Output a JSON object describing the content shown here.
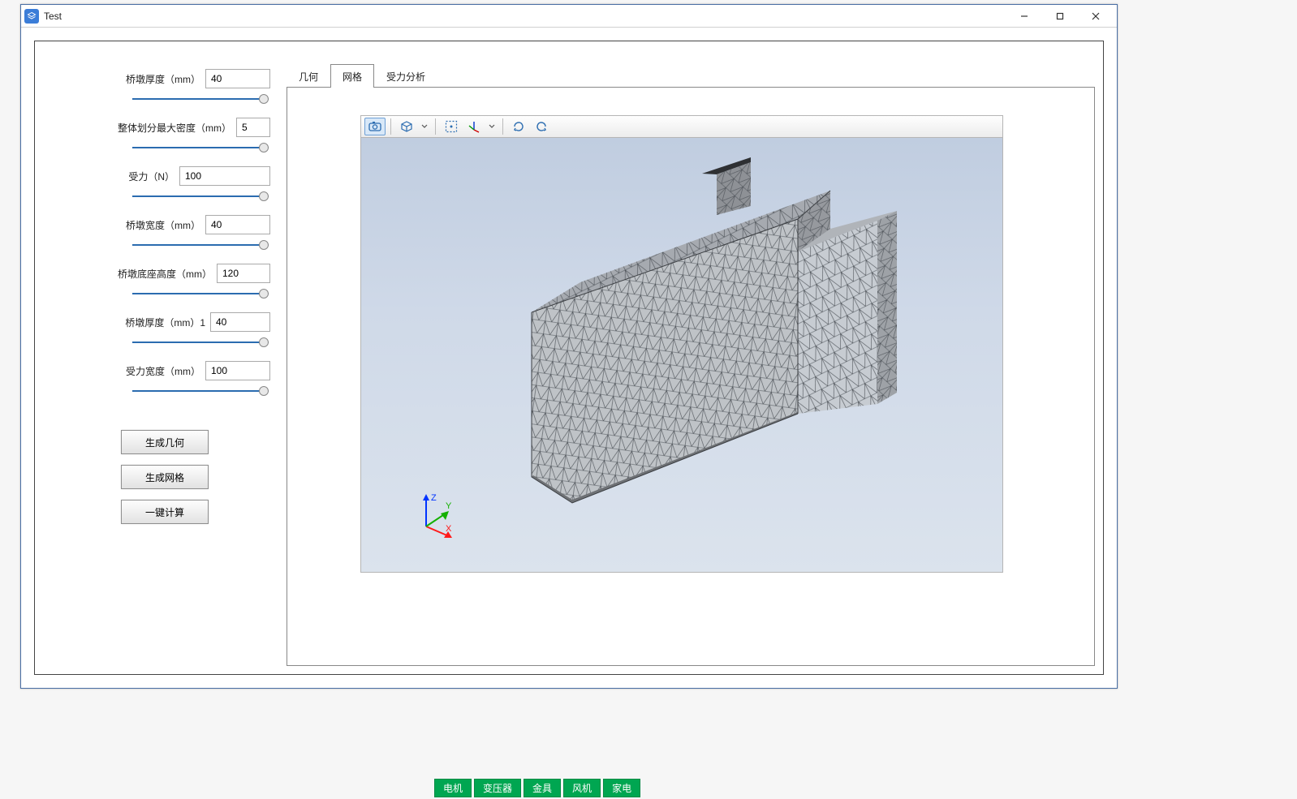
{
  "window": {
    "title": "Test"
  },
  "params": [
    {
      "label": "桥墩厚度（mm）",
      "value": "40"
    },
    {
      "label": "整体划分最大密度（mm）",
      "value": "5"
    },
    {
      "label": "受力（N）",
      "value": "100"
    },
    {
      "label": "桥墩宽度（mm）",
      "value": "40"
    },
    {
      "label": "桥墩底座高度（mm）",
      "value": "120"
    },
    {
      "label": "桥墩厚度（mm）1",
      "value": "40"
    },
    {
      "label": "受力宽度（mm）",
      "value": "100"
    }
  ],
  "buttons": {
    "generate_geometry": "生成几何",
    "generate_mesh": "生成网格",
    "compute": "一键计算"
  },
  "tabs": {
    "geometry": "几何",
    "mesh": "网格",
    "analysis": "受力分析",
    "active_index": 1
  },
  "axes": {
    "x": "X",
    "y": "Y",
    "z": "Z"
  },
  "footer": [
    "电机",
    "变压器",
    "金具",
    "风机",
    "家电"
  ]
}
